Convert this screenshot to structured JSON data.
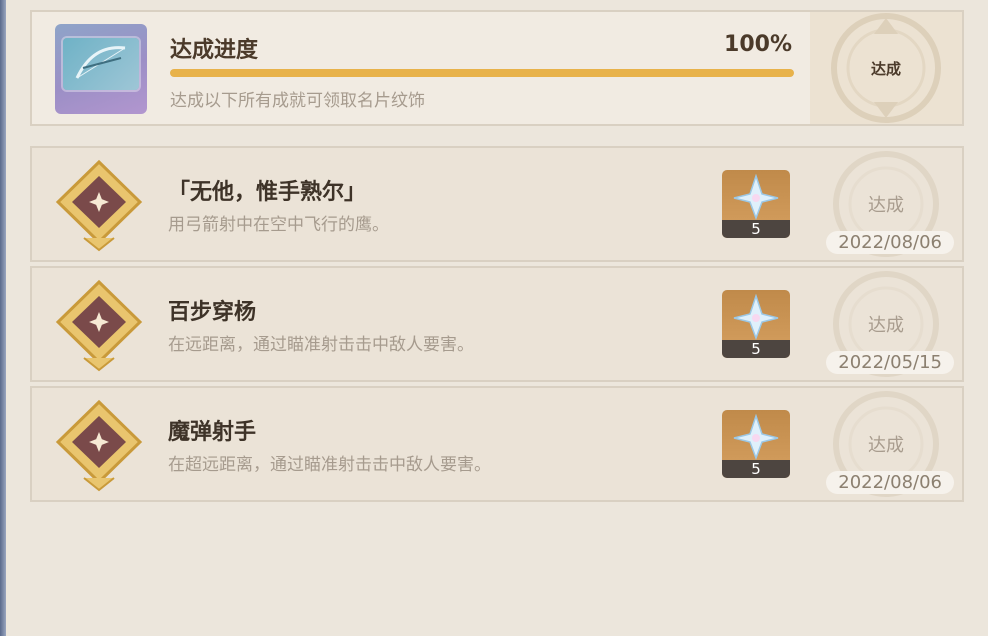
{
  "progress": {
    "title": "达成进度",
    "percent_label": "100%",
    "fraction": 1.0,
    "description": "达成以下所有成就可领取名片纹饰",
    "stamp_label": "达成"
  },
  "achievements": [
    {
      "title": "「无他，惟手熟尔」",
      "description": "用弓箭射中在空中飞行的鹰。",
      "reward_count": "5",
      "stamp_label": "达成",
      "date": "2022/08/06"
    },
    {
      "title": "百步穿杨",
      "description": "在远距离，通过瞄准射击击中敌人要害。",
      "reward_count": "5",
      "stamp_label": "达成",
      "date": "2022/05/15"
    },
    {
      "title": "魔弹射手",
      "description": "在超远距离，通过瞄准射击击中敌人要害。",
      "reward_count": "5",
      "stamp_label": "达成",
      "date": "2022/08/06"
    }
  ],
  "colors": {
    "accent_bar": "#e8b24a",
    "title_text": "#3e3328",
    "muted_text": "#a69b8e"
  }
}
